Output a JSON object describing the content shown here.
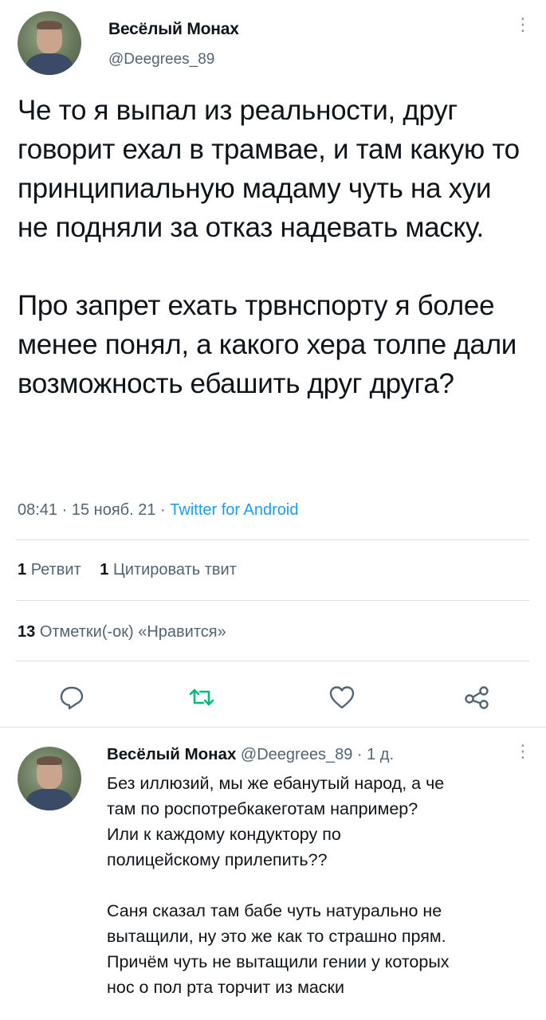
{
  "tweet": {
    "author_name": "Весёлый Монах",
    "author_handle": "@Deegrees_89",
    "text_p1": "Че то я выпал из реальности, друг говорит ехал в трамвае, и там какую то принципиальную мадаму чуть на хуи не подняли за отказ надевать маску.",
    "text_p2": "Про запрет ехать трвнспорту я более менее понял, а какого хера толпе дали возможность ебашить друг друга?",
    "time": "08:41",
    "date": "15 нояб. 21",
    "source": "Twitter for Android",
    "sep": "·"
  },
  "stats": {
    "retweets_count": "1",
    "retweets_label": "Ретвит",
    "quotes_count": "1",
    "quotes_label": "Цитировать твит",
    "likes_count": "13",
    "likes_label": "Отметки(-ок) «Нравится»"
  },
  "actions": {
    "reply_icon": "reply-icon",
    "retweet_icon": "retweet-icon",
    "like_icon": "heart-icon",
    "share_icon": "share-icon",
    "retweet_color": "#00ba7c"
  },
  "reply": {
    "author_name": "Весёлый Монах",
    "author_handle": "@Deegrees_89",
    "sep": "·",
    "age": "1 д.",
    "lines_p1": [
      "Без иллюзий, мы же ебанутый народ, а че",
      "там по роспотребкакеготам например?",
      "Или к каждому кондуктору по",
      "полицейскому прилепить??"
    ],
    "lines_p2": [
      "Саня сказал там бабе чуть натурально не",
      "вытащили, ну это же как то страшно прям.",
      "Причём чуть не вытащили гении у которых",
      "нос о пол рта торчит из маски"
    ]
  },
  "colors": {
    "text": "#0f1419",
    "secondary": "#536471",
    "link": "#1d9bf0",
    "divider": "#dfe3e7"
  }
}
